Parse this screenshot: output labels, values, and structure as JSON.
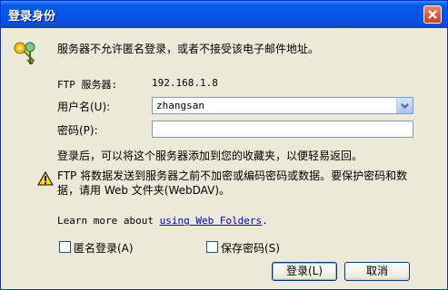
{
  "window": {
    "title": "登录身份"
  },
  "message": "服务器不允许匿名登录，或者不接受该电子邮件地址。",
  "ftp_server": {
    "label": "FTP 服务器:",
    "value": "192.168.1.8"
  },
  "username": {
    "label": "用户名(U):",
    "value": "zhangsan"
  },
  "password": {
    "label": "密码(P):",
    "value": ""
  },
  "info": "登录后，可以将这个服务器添加到您的收藏夹，以便轻易返回。",
  "warning_line1": "FTP 将数据发送到服务器之前不加密或编码密码或数据。要保护密码和数",
  "warning_line2": "据，请用 Web 文件夹(WebDAV)。",
  "learn_more": {
    "prefix": "Learn more about ",
    "link": "using Web Folders",
    "suffix": "."
  },
  "anonymous": {
    "label": "匿名登录(A)",
    "checked": false
  },
  "save_password": {
    "label": "保存密码(S)",
    "checked": false
  },
  "buttons": {
    "login": "登录(L)",
    "cancel": "取消"
  },
  "icons": {
    "title_close": "close-icon",
    "keys": "keys-icon",
    "warning": "warning-icon",
    "dropdown": "chevron-down-icon"
  }
}
